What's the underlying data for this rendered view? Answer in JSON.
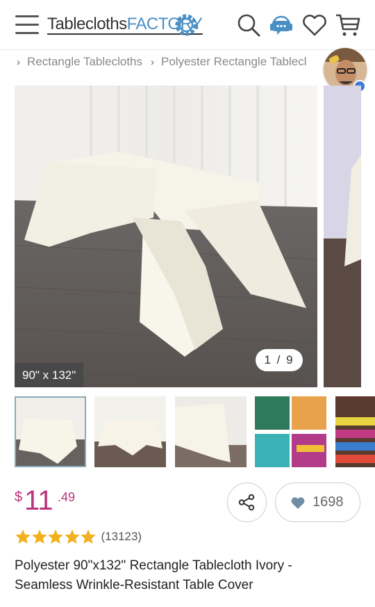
{
  "header": {
    "logo_main": "Tablecloths",
    "logo_accent": "FACTORY"
  },
  "icons": {
    "menu": "hamburger-menu-icon",
    "search": "search-icon",
    "chat": "chat-support-icon",
    "wishlist": "heart-icon",
    "cart": "cart-icon",
    "share": "share-icon",
    "like": "heart-icon",
    "star": "star-icon"
  },
  "breadcrumb": {
    "separator": "›",
    "items": [
      "Rectangle Tablecloths",
      "Polyester Rectangle Tablecl"
    ]
  },
  "gallery": {
    "size_label": "90\" x 132\"",
    "counter": "1 / 9",
    "current_index": 1,
    "total": 9
  },
  "product": {
    "price_currency": "$",
    "price_whole": "11",
    "price_cents": ".49",
    "likes": "1698",
    "rating": 5,
    "rating_count": "(13123)",
    "title": "Polyester 90\"x132\" Rectangle Tablecloth Ivory - Seamless Wrinkle-Resistant Table Cover"
  },
  "colors": {
    "price": "#b8337a",
    "star": "#f2b01e",
    "logo_accent": "#4a8fc4",
    "thumb_active_border": "#8aa9b8"
  }
}
